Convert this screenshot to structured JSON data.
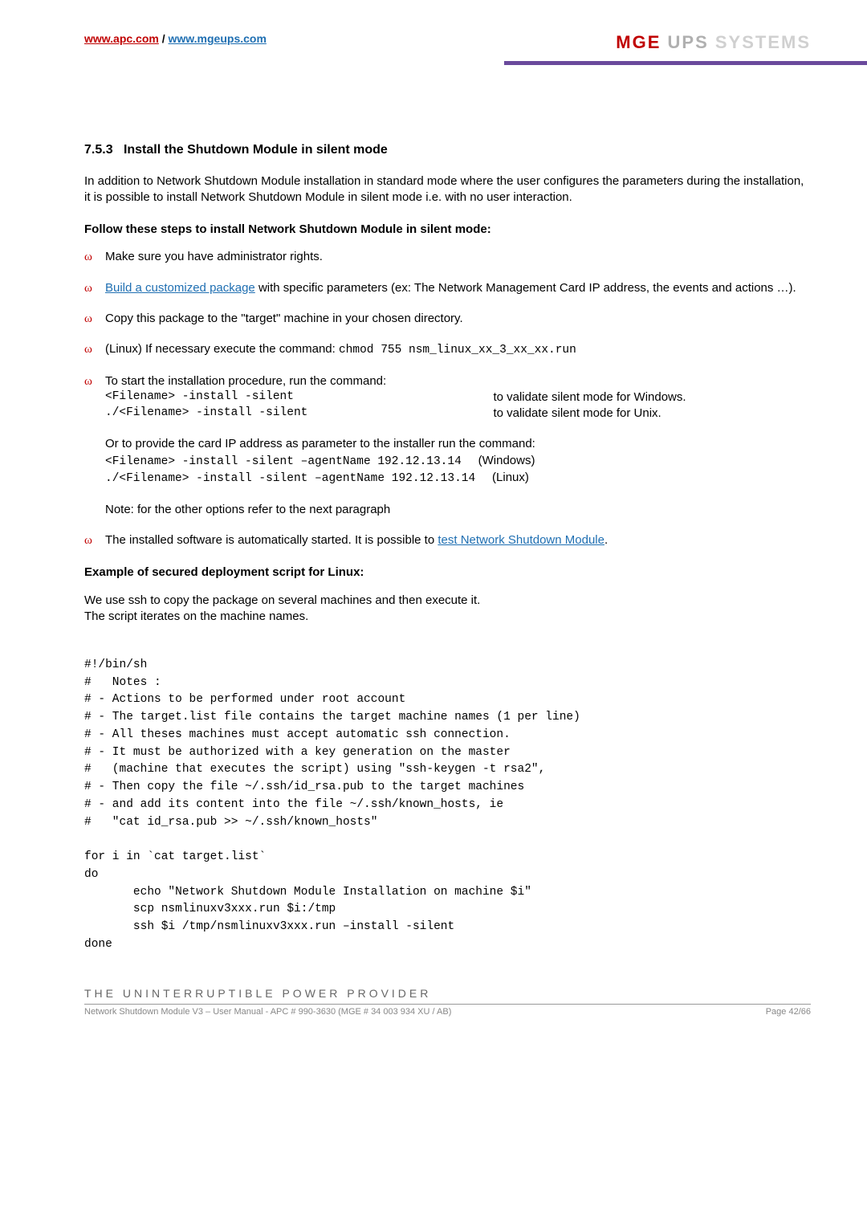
{
  "header": {
    "link_apc": "www.apc.com",
    "link_sep": " / ",
    "link_mge": "www.mgeups.com",
    "logo_mge": "MGE",
    "logo_ups": " UPS",
    "logo_sys": " SYSTEMS"
  },
  "section": {
    "number": "7.5.3",
    "title": "Install the Shutdown Module in silent mode"
  },
  "intro": "In addition to Network Shutdown Module installation in standard mode where the user configures the parameters during the installation, it is possible to install Network Shutdown Module in silent mode i.e. with no user interaction.",
  "follow_steps": "Follow these steps to install Network Shutdown Module in silent mode:",
  "bullets": {
    "b1": "Make sure you have administrator rights.",
    "b2_link": "Build a customized package",
    "b2_rest": " with specific parameters (ex: The Network Management Card IP address, the events and actions …).",
    "b3": "Copy this package to the \"target\" machine in your chosen directory.",
    "b4_pre": "(Linux) If necessary execute the command: ",
    "b4_cmd": "chmod 755 nsm_linux_xx_3_xx_xx.run",
    "b5_intro": "To start the installation procedure, run the command:",
    "b5_cmd1": "<Filename> -install -silent",
    "b5_desc1": "to validate silent mode for Windows.",
    "b5_cmd2": "./<Filename> -install -silent",
    "b5_desc2": "to validate silent mode for Unix.",
    "b5_or": "Or to provide the card IP address as parameter to the installer run the command:",
    "b5_cmd3": "<Filename> -install -silent –agentName 192.12.13.14",
    "b5_desc3": "(Windows)",
    "b5_cmd4": "./<Filename> -install -silent –agentName 192.12.13.14",
    "b5_desc4": "(Linux)",
    "b5_note": "Note: for the other options refer to the next paragraph",
    "b6_pre": "The installed software is automatically started. It is possible to ",
    "b6_link": "test Network Shutdown Module",
    "b6_post": "."
  },
  "example_title": "Example of secured deployment script for Linux:",
  "example_intro1": "We use ssh to copy the package on several machines and then execute it.",
  "example_intro2": "The script iterates on the machine names.",
  "script_lines": {
    "l1": "#!/bin/sh",
    "l2": "#   Notes :",
    "l3": "# - Actions to be performed under root account",
    "l4": "# - The target.list file contains the target machine names (1 per line)",
    "l5": "# - All theses machines must accept automatic ssh connection.",
    "l6": "# - It must be authorized with a key generation on the master",
    "l7": "#   (machine that executes the script) using \"ssh-keygen -t rsa2\",",
    "l8": "# - Then copy the file ~/.ssh/id_rsa.pub to the target machines",
    "l9": "# - and add its content into the file ~/.ssh/known_hosts, ie",
    "l10": "#   \"cat id_rsa.pub >> ~/.ssh/known_hosts\"",
    "l11": "",
    "l12": "for i in `cat target.list`",
    "l13": "do",
    "l14": "       echo \"Network Shutdown Module Installation on machine $i\"",
    "l15": "       scp nsmlinuxv3xxx.run $i:/tmp",
    "l16": "       ssh $i /tmp/nsmlinuxv3xxx.run –install -silent",
    "l17": "done"
  },
  "footer": {
    "tagline": "THE UNINTERRUPTIBLE POWER PROVIDER",
    "doc": "Network Shutdown Module V3 – User Manual - APC # 990-3630 (MGE # 34 003 934 XU / AB)",
    "page": "Page 42/66"
  }
}
